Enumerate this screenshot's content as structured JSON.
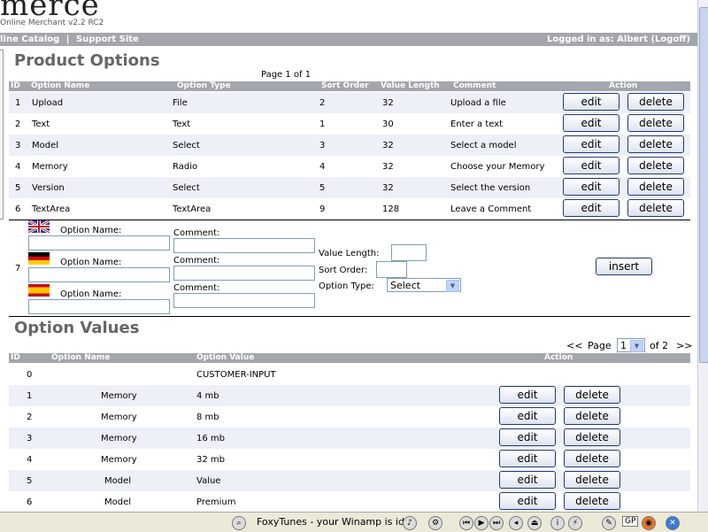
{
  "header": {
    "logo_text": "merce",
    "subtitle": "Online Merchant v2.2 RC2",
    "nav_links": [
      "line Catalog",
      "Support Site"
    ],
    "nav_separator": "|",
    "user_status": "Logged in as: Albert (Logoff)"
  },
  "options_section": {
    "title": "Product Options",
    "page_info": "Page 1 of 1",
    "columns": [
      "ID",
      "Option Name",
      "Option Type",
      "Sort Order",
      "Value Length",
      "Comment",
      "Action"
    ],
    "rows": [
      {
        "id": "1",
        "name": "Upload",
        "type": "File",
        "sort": "2",
        "length": "32",
        "comment": "Upload a file"
      },
      {
        "id": "2",
        "name": "Text",
        "type": "Text",
        "sort": "1",
        "length": "30",
        "comment": "Enter a text"
      },
      {
        "id": "3",
        "name": "Model",
        "type": "Select",
        "sort": "3",
        "length": "32",
        "comment": "Select a model"
      },
      {
        "id": "4",
        "name": "Memory",
        "type": "Radio",
        "sort": "4",
        "length": "32",
        "comment": "Choose your Memory"
      },
      {
        "id": "5",
        "name": "Version",
        "type": "Select",
        "sort": "5",
        "length": "32",
        "comment": "Select the version"
      },
      {
        "id": "6",
        "name": "TextArea",
        "type": "TextArea",
        "sort": "9",
        "length": "128",
        "comment": "Leave a Comment"
      }
    ],
    "edit_label": "edit",
    "delete_label": "delete"
  },
  "insert_form": {
    "row_id": "7",
    "option_name_label": "Option Name:",
    "comment_label": "Comment:",
    "value_length_label": "Value Length:",
    "sort_order_label": "Sort Order:",
    "option_type_label": "Option Type:",
    "option_type_value": "Select",
    "insert_label": "insert",
    "languages": [
      "english-flag",
      "german-flag",
      "spanish-flag"
    ]
  },
  "values_section": {
    "title": "Option Values",
    "pager": {
      "prev": "<<",
      "page_label": "Page",
      "current_page": "1",
      "of_label": "of 2",
      "next": ">>"
    },
    "columns": [
      "ID",
      "Option Name",
      "Option Value",
      "Action"
    ],
    "rows": [
      {
        "id": "0",
        "name": "",
        "value": "CUSTOMER-INPUT"
      },
      {
        "id": "1",
        "name": "Memory",
        "value": "4 mb"
      },
      {
        "id": "2",
        "name": "Memory",
        "value": "8 mb"
      },
      {
        "id": "3",
        "name": "Memory",
        "value": "16 mb"
      },
      {
        "id": "4",
        "name": "Memory",
        "value": "32 mb"
      },
      {
        "id": "5",
        "name": "Model",
        "value": "Value"
      },
      {
        "id": "6",
        "name": "Model",
        "value": "Premium"
      }
    ]
  },
  "statusbar": {
    "foxytunes_text": "FoxyTunes - your Winamp is idl",
    "badge": "GP"
  },
  "colors": {
    "header_bar": "#a3a7ad",
    "row_alt": "#edf0f7",
    "title": "#666666",
    "button_border": "#1f3a7a"
  }
}
